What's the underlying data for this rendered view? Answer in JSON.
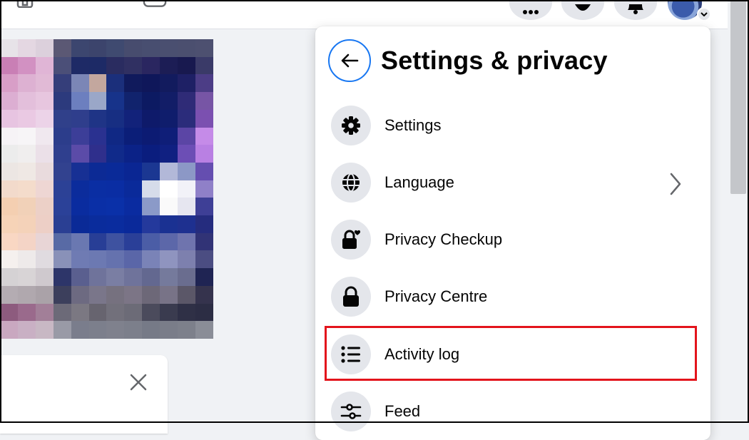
{
  "settings_panel": {
    "title": "Settings & privacy",
    "items": [
      {
        "label": "Settings",
        "icon": "gear-icon"
      },
      {
        "label": "Language",
        "icon": "globe-icon",
        "has_submenu": true
      },
      {
        "label": "Privacy Checkup",
        "icon": "lock-heart-icon"
      },
      {
        "label": "Privacy Centre",
        "icon": "lock-icon"
      },
      {
        "label": "Activity log",
        "icon": "list-icon",
        "highlighted": true
      },
      {
        "label": "Feed",
        "icon": "sliders-icon"
      }
    ]
  },
  "colors": {
    "accent": "#1877f2",
    "highlight": "#e3141c",
    "icon_bg": "#e4e6eb",
    "text": "#050505"
  }
}
